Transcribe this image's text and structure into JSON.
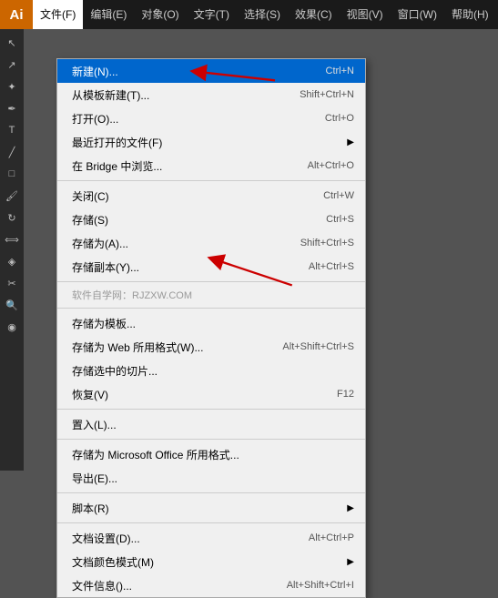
{
  "app": {
    "logo": "Ai",
    "logo_bg": "#cc6600"
  },
  "menubar": {
    "items": [
      {
        "label": "文件(F)",
        "active": true
      },
      {
        "label": "编辑(E)",
        "active": false
      },
      {
        "label": "对象(O)",
        "active": false
      },
      {
        "label": "文字(T)",
        "active": false
      },
      {
        "label": "选择(S)",
        "active": false
      },
      {
        "label": "效果(C)",
        "active": false
      },
      {
        "label": "视图(V)",
        "active": false
      },
      {
        "label": "窗口(W)",
        "active": false
      },
      {
        "label": "帮助(H)",
        "active": false
      }
    ]
  },
  "filemenu": {
    "items": [
      {
        "label": "新建(N)...",
        "shortcut": "Ctrl+N",
        "type": "item",
        "highlighted": true
      },
      {
        "label": "从模板新建(T)...",
        "shortcut": "Shift+Ctrl+N",
        "type": "item"
      },
      {
        "label": "打开(O)...",
        "shortcut": "Ctrl+O",
        "type": "item"
      },
      {
        "label": "最近打开的文件(F)",
        "shortcut": "",
        "type": "submenu"
      },
      {
        "label": "在 Bridge 中浏览...",
        "shortcut": "Alt+Ctrl+O",
        "type": "item"
      },
      {
        "type": "separator"
      },
      {
        "label": "关闭(C)",
        "shortcut": "Ctrl+W",
        "type": "item"
      },
      {
        "label": "存储(S)",
        "shortcut": "Ctrl+S",
        "type": "item"
      },
      {
        "label": "",
        "shortcut": "Shift+Ctrl+S",
        "type": "item",
        "grayed": false,
        "is_saveas": true
      },
      {
        "label": "",
        "shortcut": "Alt+Ctrl+S",
        "type": "item",
        "grayed": false,
        "is_saveall": true
      },
      {
        "type": "separator"
      },
      {
        "label": "软件自学网：RJZXW.COM",
        "type": "watermark"
      },
      {
        "type": "separator"
      },
      {
        "label": "存储为模板...",
        "shortcut": "",
        "type": "item"
      },
      {
        "label": "存储为 Web 所用格式(W)...",
        "shortcut": "Alt+Shift+Ctrl+S",
        "type": "item"
      },
      {
        "label": "存储选中的切片...",
        "shortcut": "",
        "type": "item"
      },
      {
        "label": "恢复(V)",
        "shortcut": "F12",
        "type": "item"
      },
      {
        "type": "separator"
      },
      {
        "label": "置入(L)...",
        "shortcut": "",
        "type": "item"
      },
      {
        "type": "separator"
      },
      {
        "label": "存储为 Microsoft Office 所用格式...",
        "shortcut": "",
        "type": "item"
      },
      {
        "label": "导出(E)...",
        "shortcut": "",
        "type": "item"
      },
      {
        "type": "separator"
      },
      {
        "label": "脚本(R)",
        "shortcut": "",
        "type": "submenu"
      },
      {
        "type": "separator"
      },
      {
        "label": "文档设置(D)...",
        "shortcut": "Alt+Ctrl+P",
        "type": "item"
      },
      {
        "label": "文档颜色模式(M)",
        "shortcut": "",
        "type": "submenu"
      },
      {
        "label": "文件信息()...",
        "shortcut": "Alt+Shift+Ctrl+I",
        "type": "item"
      }
    ],
    "saveas_label": "存储为(A)...",
    "saveall_label": "存储副本(Y)..."
  },
  "tools": [
    "↖",
    "✥",
    "✎",
    "T",
    "⬚",
    "⟳",
    "◈",
    "✂",
    "◉"
  ]
}
